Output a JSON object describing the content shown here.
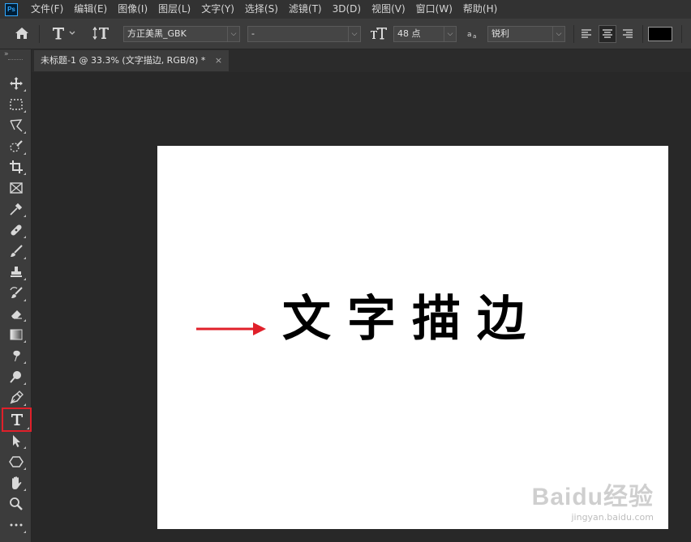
{
  "menu": [
    "文件(F)",
    "编辑(E)",
    "图像(I)",
    "图层(L)",
    "文字(Y)",
    "选择(S)",
    "滤镜(T)",
    "3D(D)",
    "视图(V)",
    "窗口(W)",
    "帮助(H)"
  ],
  "options": {
    "font_family": "方正美黑_GBK",
    "font_style": "-",
    "font_size": "48 点",
    "antialias": "锐利",
    "color": "#000000"
  },
  "tab": {
    "title": "未标题-1 @ 33.3% (文字描边, RGB/8) *",
    "close": "×"
  },
  "canvas": {
    "text": "文字描边"
  },
  "watermark": {
    "brand": "Baidu经验",
    "url": "jingyan.baidu.com"
  },
  "colors": {
    "accent": "#e0202a",
    "panel": "#3c3c3c",
    "workspace": "#282828"
  },
  "icons": [
    "home-icon",
    "type-tool-icon",
    "orientation-icon",
    "font-size-icon",
    "antialias-icon",
    "align-left-icon",
    "align-center-icon",
    "align-right-icon"
  ]
}
